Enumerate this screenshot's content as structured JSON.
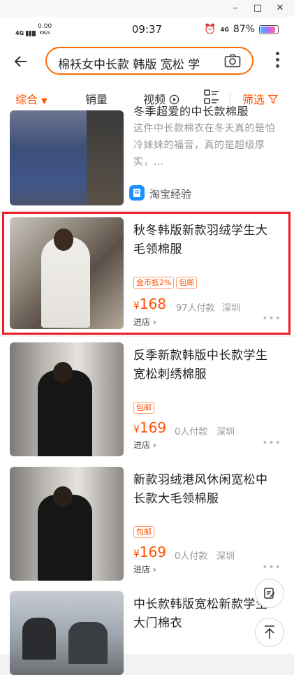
{
  "window": {
    "minimize": "–",
    "maximize": "□",
    "close": "✕"
  },
  "status": {
    "signal": "4G",
    "speed_value": "0.00",
    "speed_unit": "KB/s",
    "time": "09:37",
    "alarm": "⏰",
    "network": "4G",
    "battery": "87%"
  },
  "search": {
    "query": "棉袄女中长款 韩版 宽松 学"
  },
  "sort": {
    "items": [
      "综合",
      "销量",
      "视频"
    ],
    "filter": "筛选"
  },
  "icons": {
    "back": "arrow-left-icon",
    "camera": "camera-icon",
    "more": "more-vertical-icon",
    "layout": "grid-list-icon",
    "filter": "funnel-icon",
    "note": "edit-note-icon",
    "top": "back-to-top-icon"
  },
  "colors": {
    "accent": "#ff5000",
    "highlight": "#ee1c24"
  },
  "products": [
    {
      "title_partial": "冬季超爱的中长款棉服",
      "desc": "这件中长款棉衣在冬天真的是怕冷妹妹的福音，真的是超级厚实，…",
      "source": "淘宝经验"
    },
    {
      "title": "秋冬韩版新款羽绒学生大毛领棉服",
      "tags": [
        "金币抵2%",
        "包邮"
      ],
      "currency": "¥",
      "price": "168",
      "sold": "97人付款",
      "location": "深圳",
      "shop": "进店 ›"
    },
    {
      "title": "反季新款韩版中长款学生宽松刺绣棉服",
      "tags": [
        "包邮"
      ],
      "currency": "¥",
      "price": "169",
      "sold": "0人付款",
      "location": "深圳",
      "shop": "进店 ›"
    },
    {
      "title": "新款羽绒港风休闲宽松中长款大毛领棉服",
      "tags": [
        "包邮"
      ],
      "currency": "¥",
      "price": "169",
      "sold": "0人付款",
      "location": "深圳",
      "shop": "进店 ›"
    },
    {
      "title": "中长款韩版宽松新款学生大门棉衣"
    }
  ]
}
